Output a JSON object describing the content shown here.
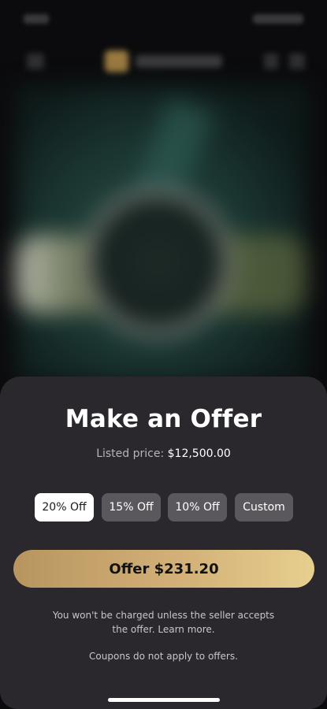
{
  "offer_sheet": {
    "title": "Make an Offer",
    "listed_label": "Listed price:",
    "listed_price": "$12,500.00",
    "discount_options": [
      {
        "label": "20% Off",
        "selected": true
      },
      {
        "label": "15% Off",
        "selected": false
      },
      {
        "label": "10% Off",
        "selected": false
      },
      {
        "label": "Custom",
        "selected": false
      }
    ],
    "offer_button": "Offer $231.20",
    "disclaimer": "You won't be charged unless the seller accepts the offer. Learn more.",
    "coupon_note": "Coupons do not apply to offers."
  },
  "colors": {
    "sheet_background": "#2a282d",
    "chip_background": "#5a585d",
    "chip_selected": "#ffffff",
    "accent_gold_start": "#b8955f",
    "accent_gold_end": "#e7cf8f"
  }
}
